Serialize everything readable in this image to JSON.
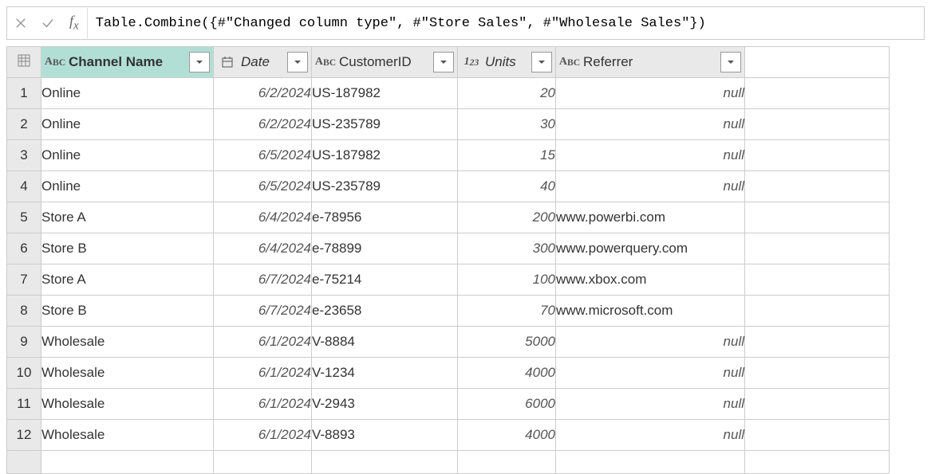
{
  "formula": "Table.Combine({#\"Changed column type\", #\"Store Sales\", #\"Wholesale Sales\"})",
  "columns": {
    "channel": "Channel Name",
    "date": "Date",
    "customer": "CustomerID",
    "units": "Units",
    "referrer": "Referrer"
  },
  "rows": [
    {
      "n": "1",
      "channel": "Online",
      "date": "6/2/2024",
      "cust": "US-187982",
      "units": "20",
      "ref": "null",
      "refnull": true
    },
    {
      "n": "2",
      "channel": "Online",
      "date": "6/2/2024",
      "cust": "US-235789",
      "units": "30",
      "ref": "null",
      "refnull": true
    },
    {
      "n": "3",
      "channel": "Online",
      "date": "6/5/2024",
      "cust": "US-187982",
      "units": "15",
      "ref": "null",
      "refnull": true
    },
    {
      "n": "4",
      "channel": "Online",
      "date": "6/5/2024",
      "cust": "US-235789",
      "units": "40",
      "ref": "null",
      "refnull": true
    },
    {
      "n": "5",
      "channel": "Store A",
      "date": "6/4/2024",
      "cust": "e-78956",
      "units": "200",
      "ref": "www.powerbi.com",
      "refnull": false
    },
    {
      "n": "6",
      "channel": "Store B",
      "date": "6/4/2024",
      "cust": "e-78899",
      "units": "300",
      "ref": "www.powerquery.com",
      "refnull": false
    },
    {
      "n": "7",
      "channel": "Store A",
      "date": "6/7/2024",
      "cust": "e-75214",
      "units": "100",
      "ref": "www.xbox.com",
      "refnull": false
    },
    {
      "n": "8",
      "channel": "Store B",
      "date": "6/7/2024",
      "cust": "e-23658",
      "units": "70",
      "ref": "www.microsoft.com",
      "refnull": false
    },
    {
      "n": "9",
      "channel": "Wholesale",
      "date": "6/1/2024",
      "cust": "V-8884",
      "units": "5000",
      "ref": "null",
      "refnull": true
    },
    {
      "n": "10",
      "channel": "Wholesale",
      "date": "6/1/2024",
      "cust": "V-1234",
      "units": "4000",
      "ref": "null",
      "refnull": true
    },
    {
      "n": "11",
      "channel": "Wholesale",
      "date": "6/1/2024",
      "cust": "V-2943",
      "units": "6000",
      "ref": "null",
      "refnull": true
    },
    {
      "n": "12",
      "channel": "Wholesale",
      "date": "6/1/2024",
      "cust": "V-8893",
      "units": "4000",
      "ref": "null",
      "refnull": true
    }
  ]
}
